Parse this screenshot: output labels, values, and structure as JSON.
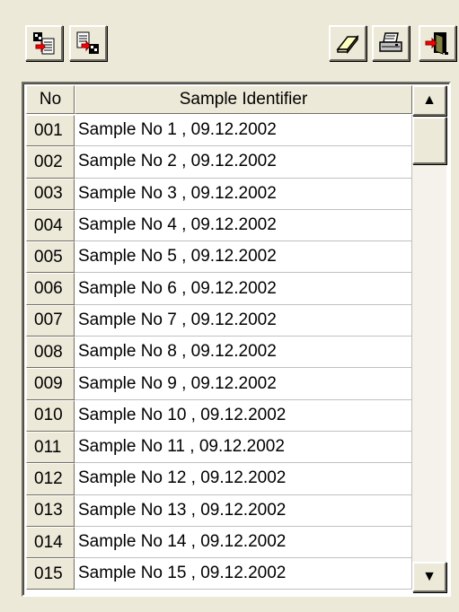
{
  "toolbar": {
    "buttons": [
      {
        "name": "import-icon"
      },
      {
        "name": "export-icon"
      },
      {
        "name": "eraser-icon"
      },
      {
        "name": "printer-icon"
      },
      {
        "name": "exit-door-icon"
      }
    ]
  },
  "table": {
    "columns": [
      "No",
      "Sample Identifier"
    ],
    "rows": [
      {
        "no": "001",
        "id": "Sample No 1 , 09.12.2002"
      },
      {
        "no": "002",
        "id": "Sample No 2 , 09.12.2002"
      },
      {
        "no": "003",
        "id": "Sample No 3 , 09.12.2002"
      },
      {
        "no": "004",
        "id": "Sample No 4 , 09.12.2002"
      },
      {
        "no": "005",
        "id": "Sample No 5 , 09.12.2002"
      },
      {
        "no": "006",
        "id": "Sample No 6 , 09.12.2002"
      },
      {
        "no": "007",
        "id": "Sample No 7 , 09.12.2002"
      },
      {
        "no": "008",
        "id": "Sample No 8 , 09.12.2002"
      },
      {
        "no": "009",
        "id": "Sample No 9 , 09.12.2002"
      },
      {
        "no": "010",
        "id": "Sample No 10 , 09.12.2002"
      },
      {
        "no": "011",
        "id": "Sample No 11 , 09.12.2002"
      },
      {
        "no": "012",
        "id": "Sample No 12 , 09.12.2002"
      },
      {
        "no": "013",
        "id": "Sample No 13 , 09.12.2002"
      },
      {
        "no": "014",
        "id": "Sample No 14 , 09.12.2002"
      },
      {
        "no": "015",
        "id": "Sample No 15 , 09.12.2002"
      }
    ]
  },
  "scrollbar": {
    "up_glyph": "▲",
    "down_glyph": "▼"
  }
}
